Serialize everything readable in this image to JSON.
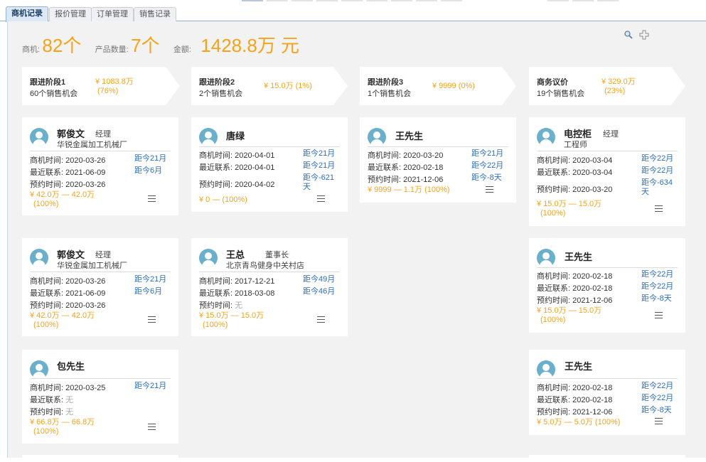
{
  "tabs": [
    {
      "label": "商机记录"
    },
    {
      "label": "报价管理"
    },
    {
      "label": "订单管理"
    },
    {
      "label": "销售记录"
    }
  ],
  "summary": {
    "opportunity_label": "商机:",
    "opportunity_value": "82个",
    "product_label": "产品数量:",
    "product_value": "7个",
    "amount_label": "金额:",
    "amount_value": "1428.8万 元"
  },
  "stages": [
    {
      "name": "跟进阶段1",
      "count": "60个销售机会",
      "amount": "¥ 1083.8万",
      "pct": "(76%)"
    },
    {
      "name": "跟进阶段2",
      "count": "2个销售机会",
      "amount": "¥ 15.0万 (1%)",
      "pct": ""
    },
    {
      "name": "跟进阶段3",
      "count": "1个销售机会",
      "amount": "¥ 9999 (0%)",
      "pct": ""
    },
    {
      "name": "商务议价",
      "count": "19个销售机会",
      "amount": "¥ 329.0万",
      "pct": "(23%)"
    }
  ],
  "labels": {
    "opp_time": "商机时间:",
    "last_contact": "最近联系:",
    "appointment": "预约时间:"
  },
  "cards": [
    {
      "name": "郭俊文",
      "title": "经理",
      "company": "华锐金属加工机械厂",
      "opp_time": "2020-03-26",
      "opp_dist": "距今21月",
      "last_contact": "2021-06-09",
      "last_dist": "距今6月",
      "appointment": "2020-03-26",
      "appt_dist": "",
      "range": "¥ 42.0万 — 42.0万",
      "pct": "(100%)"
    },
    {
      "name": "唐绿",
      "title": "",
      "company": "",
      "opp_time": "2020-04-01",
      "opp_dist": "距今21月",
      "last_contact": "2020-04-01",
      "last_dist": "距今21月",
      "appointment": "2020-04-02",
      "appt_dist": "距今-621天",
      "range": "¥ 0 — (100%)",
      "pct": ""
    },
    {
      "name": "王先生",
      "title": "",
      "company": "",
      "opp_time": "2020-03-20",
      "opp_dist": "距今21月",
      "last_contact": "2020-02-18",
      "last_dist": "距今22月",
      "appointment": "2021-12-06",
      "appt_dist": "距今-8天",
      "range": "¥ 9999 — 1.1万 (100%)",
      "pct": ""
    },
    {
      "name": "电控柜",
      "title": "经理",
      "company": "工程师",
      "opp_time": "2020-03-04",
      "opp_dist": "距今22月",
      "last_contact": "2020-03-04",
      "last_dist": "距今22月",
      "appointment": "2020-03-20",
      "appt_dist": "距今-634天",
      "range": "¥ 15.0万 — 15.0万",
      "pct": "(100%)"
    },
    {
      "name": "郭俊文",
      "title": "经理",
      "company": "华锐金属加工机械厂",
      "opp_time": "2020-03-26",
      "opp_dist": "距今21月",
      "last_contact": "2021-06-09",
      "last_dist": "距今6月",
      "appointment": "2020-03-26",
      "appt_dist": "",
      "range": "¥ 42.0万 — 42.0万",
      "pct": "(100%)"
    },
    {
      "name": "王总",
      "title": "董事长",
      "company": "北京青鸟健身中关村店",
      "opp_time": "2017-12-21",
      "opp_dist": "距今49月",
      "last_contact": "2018-03-08",
      "last_dist": "距今46月",
      "appointment": "无",
      "appt_dist": "",
      "range": "¥ 15.0万 — 15.0万",
      "pct": "(100%)"
    },
    {
      "name": "王先生",
      "title": "",
      "company": "",
      "opp_time": "2020-02-18",
      "opp_dist": "距今22月",
      "last_contact": "2020-02-18",
      "last_dist": "距今22月",
      "appointment": "2021-12-06",
      "appt_dist": "距今-8天",
      "range": "¥ 15.0万 — 15.0万",
      "pct": "(100%)"
    },
    {
      "name": "包先生",
      "title": "",
      "company": "",
      "opp_time": "2020-03-25",
      "opp_dist": "距今21月",
      "last_contact": "无",
      "last_dist": "",
      "appointment": "无",
      "appt_dist": "",
      "range": "¥ 66.8万 — 66.8万",
      "pct": "(100%)"
    },
    {
      "name": "王先生",
      "title": "",
      "company": "",
      "opp_time": "2020-02-18",
      "opp_dist": "距今22月",
      "last_contact": "2020-02-18",
      "last_dist": "距今22月",
      "appointment": "2021-12-06",
      "appt_dist": "距今-8天",
      "range": "¥ 5.0万 — 5.0万 (100%)",
      "pct": ""
    }
  ],
  "colors": {
    "accent_orange": "#f5a318",
    "link_blue": "#2f6fb6",
    "avatar": "#6aafcb"
  },
  "icons": {
    "search": "search-icon",
    "add": "add-icon",
    "menu": "menu-icon"
  }
}
